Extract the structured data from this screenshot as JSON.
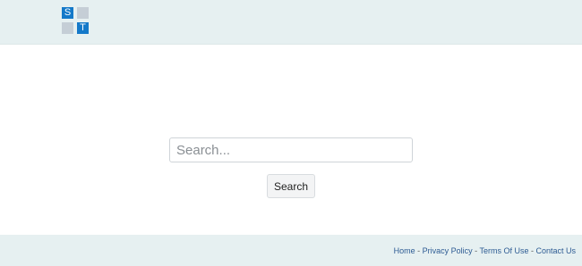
{
  "header": {
    "logo": {
      "letter_top": "S",
      "letter_bottom": "T"
    }
  },
  "search": {
    "placeholder": "Search...",
    "value": "",
    "button_label": "Search"
  },
  "footer": {
    "links": [
      "Home",
      "Privacy Policy",
      "Terms Of Use",
      "Contact Us"
    ],
    "separator": " - "
  },
  "colors": {
    "accent": "#1479c9",
    "band": "#e6f0f1",
    "link": "#2d5b93"
  }
}
